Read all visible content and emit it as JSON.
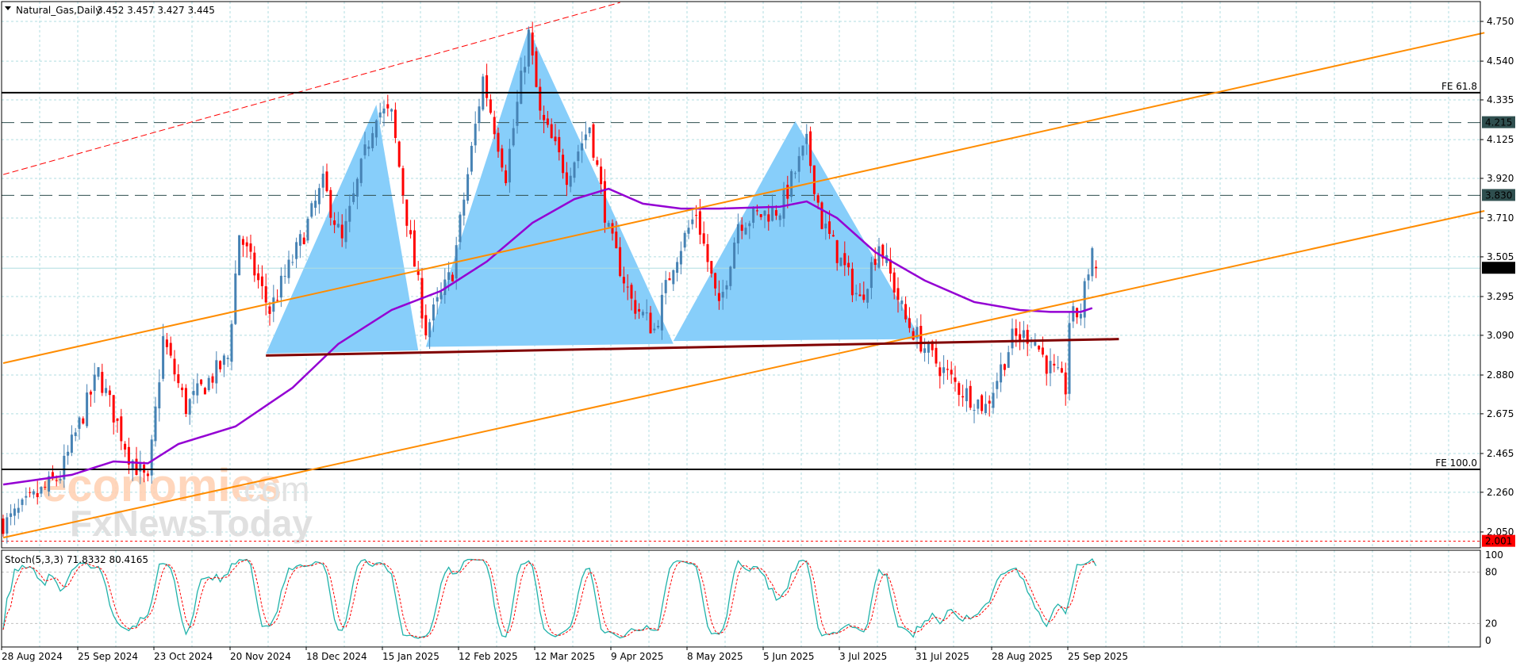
{
  "header": {
    "symbol": "Natural_Gas,Daily",
    "ohlc": "3.452 3.457 3.427 3.445",
    "menu_icon": "triangle-down-icon"
  },
  "watermark": {
    "brand1": "economies",
    "brand1_suffix": ".com",
    "brand2": "FxNewsToday"
  },
  "colors": {
    "bull": "#4682b4",
    "bear": "#ff0000",
    "ma": "#9400d3",
    "channel": "#ff8c00",
    "pattern": "#87cefa",
    "neckline": "#800000",
    "stoch_main": "#20b2aa",
    "stoch_signal": "#ff0000",
    "grid": "#b0dde0"
  },
  "chart_data": [
    {
      "type": "candlestick",
      "title": "Natural_Gas,Daily",
      "x_unit": "bar index (daily)",
      "xlim": [
        0,
        388
      ],
      "ylim": [
        1.95,
        4.85
      ],
      "grid": true,
      "y_ticks": [
        "4.750",
        "4.540",
        "4.335",
        "4.125",
        "3.920",
        "3.710",
        "3.505",
        "3.295",
        "3.090",
        "2.880",
        "2.675",
        "2.465",
        "2.260",
        "2.050"
      ],
      "x_ticks": [
        {
          "bar": 0,
          "label": "28 Aug 2024"
        },
        {
          "bar": 20,
          "label": "25 Sep 2024"
        },
        {
          "bar": 40,
          "label": "23 Oct 2024"
        },
        {
          "bar": 60,
          "label": "20 Nov 2024"
        },
        {
          "bar": 80,
          "label": "18 Dec 2024"
        },
        {
          "bar": 100,
          "label": "15 Jan 2025"
        },
        {
          "bar": 120,
          "label": "12 Feb 2025"
        },
        {
          "bar": 140,
          "label": "12 Mar 2025"
        },
        {
          "bar": 160,
          "label": "9 Apr 2025"
        },
        {
          "bar": 180,
          "label": "8 May 2025"
        },
        {
          "bar": 200,
          "label": "5 Jun 2025"
        },
        {
          "bar": 220,
          "label": "3 Jul 2025"
        },
        {
          "bar": 240,
          "label": "31 Jul 2025"
        },
        {
          "bar": 260,
          "label": "28 Aug 2025"
        },
        {
          "bar": 280,
          "label": "25 Sep 2025"
        }
      ],
      "price_path": [
        [
          0,
          2.1
        ],
        [
          1,
          2.1
        ],
        [
          15,
          2.35
        ],
        [
          25,
          2.89
        ],
        [
          33,
          2.46
        ],
        [
          38,
          2.3
        ],
        [
          42,
          3.07
        ],
        [
          48,
          2.71
        ],
        [
          59,
          2.97
        ],
        [
          62,
          3.63
        ],
        [
          70,
          3.22
        ],
        [
          78,
          3.58
        ],
        [
          84,
          3.89
        ],
        [
          89,
          3.58
        ],
        [
          98,
          4.28
        ],
        [
          102,
          4.25
        ],
        [
          107,
          3.58
        ],
        [
          111,
          3.12
        ],
        [
          118,
          3.43
        ],
        [
          126,
          4.45
        ],
        [
          132,
          3.94
        ],
        [
          138,
          4.68
        ],
        [
          141,
          4.25
        ],
        [
          148,
          3.94
        ],
        [
          154,
          4.2
        ],
        [
          159,
          3.63
        ],
        [
          165,
          3.27
        ],
        [
          171,
          3.12
        ],
        [
          176,
          3.48
        ],
        [
          182,
          3.74
        ],
        [
          188,
          3.22
        ],
        [
          193,
          3.69
        ],
        [
          204,
          3.76
        ],
        [
          211,
          4.1
        ],
        [
          215,
          3.69
        ],
        [
          225,
          3.27
        ],
        [
          230,
          3.58
        ],
        [
          237,
          3.17
        ],
        [
          244,
          2.97
        ],
        [
          251,
          2.81
        ],
        [
          258,
          2.71
        ],
        [
          265,
          3.07
        ],
        [
          270,
          3.1
        ],
        [
          274,
          2.94
        ],
        [
          279,
          2.81
        ],
        [
          280,
          3.17
        ],
        [
          283,
          3.22
        ],
        [
          286,
          3.55
        ],
        [
          287,
          3.445
        ]
      ],
      "moving_average": [
        [
          0,
          2.301
        ],
        [
          18,
          2.352
        ],
        [
          29,
          2.423
        ],
        [
          38,
          2.413
        ],
        [
          46,
          2.515
        ],
        [
          61,
          2.608
        ],
        [
          76,
          2.813
        ],
        [
          88,
          3.044
        ],
        [
          102,
          3.224
        ],
        [
          115,
          3.325
        ],
        [
          127,
          3.48
        ],
        [
          139,
          3.685
        ],
        [
          150,
          3.81
        ],
        [
          159,
          3.865
        ],
        [
          168,
          3.786
        ],
        [
          178,
          3.76
        ],
        [
          188,
          3.76
        ],
        [
          204,
          3.77
        ],
        [
          211,
          3.798
        ],
        [
          219,
          3.71
        ],
        [
          229,
          3.53
        ],
        [
          242,
          3.38
        ],
        [
          255,
          3.266
        ],
        [
          267,
          3.224
        ],
        [
          275,
          3.214
        ],
        [
          280,
          3.214
        ],
        [
          283,
          3.214
        ],
        [
          286,
          3.234
        ]
      ],
      "patterns": [
        [
          [
            69,
            2.993
          ],
          [
            98,
            4.31
          ],
          [
            109,
            3.01
          ]
        ],
        [
          [
            111,
            3.029
          ],
          [
            138,
            4.71
          ],
          [
            176,
            3.045
          ]
        ],
        [
          [
            176,
            3.06
          ],
          [
            208,
            4.223
          ],
          [
            241,
            3.07
          ]
        ]
      ],
      "neckline": [
        [
          69,
          2.983
        ],
        [
          293,
          3.07
        ]
      ],
      "channel_upper": [
        [
          0,
          2.943
        ],
        [
          389,
          4.69
        ]
      ],
      "channel_lower": [
        [
          0,
          2.02
        ],
        [
          389,
          3.748
        ]
      ],
      "red_trendline": [
        [
          0,
          3.94
        ],
        [
          162,
          4.85
        ]
      ],
      "levels": [
        {
          "price": 4.373,
          "label": "FE 61.8",
          "style": "solid"
        },
        {
          "price": 2.381,
          "label": "FE 100.0",
          "style": "solid"
        },
        {
          "price": 4.215,
          "label": "4.215",
          "style": "dashed"
        },
        {
          "price": 3.83,
          "label": "3.830",
          "style": "dashed"
        },
        {
          "price": 2.001,
          "label": "2.001",
          "style": "dotted-red"
        },
        {
          "price": 3.445,
          "label": "3.445",
          "style": "current"
        }
      ]
    },
    {
      "type": "line",
      "title": "Stoch(5,3,3)",
      "values_label": "71.8332 80.4165",
      "ylim": [
        0,
        100
      ],
      "y_ticks": [
        "100",
        "80",
        "20",
        "0"
      ],
      "series": [
        {
          "name": "%K"
        },
        {
          "name": "%D"
        }
      ]
    }
  ]
}
